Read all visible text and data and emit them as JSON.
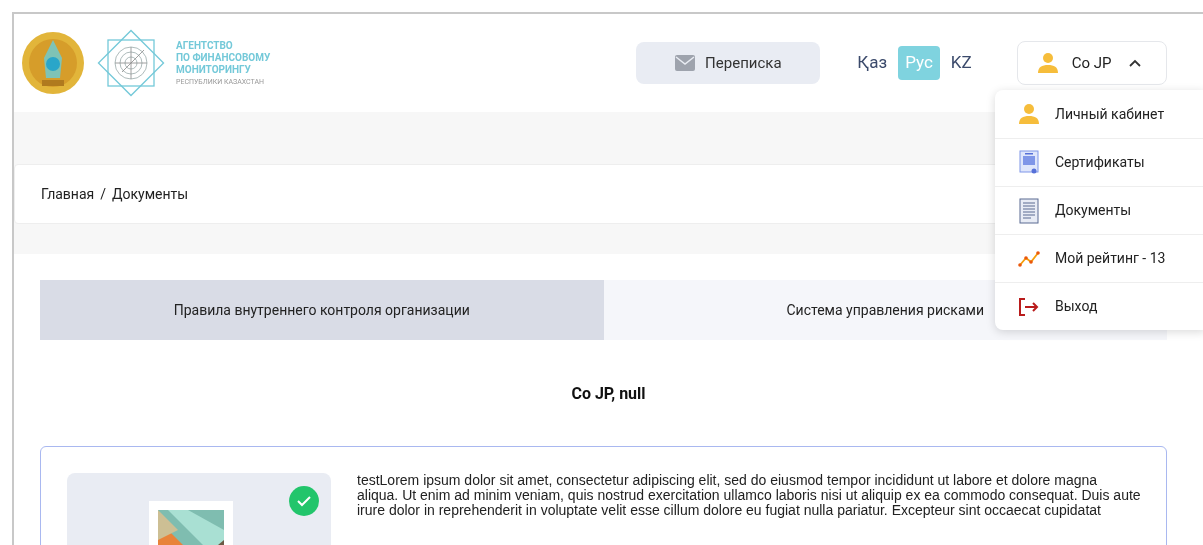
{
  "logo": {
    "title_lines": [
      "АГЕНТСТВО",
      "ПО ФИНАНСОВОМУ",
      "МОНИТОРИНГУ"
    ],
    "subtitle": "РЕСПУБЛИКИ КАЗАХСТАН"
  },
  "header": {
    "messages_button": "Переписка",
    "languages": [
      {
        "label": "Қаз",
        "selected": false
      },
      {
        "label": "Рус",
        "selected": true
      },
      {
        "label": "KZ",
        "selected": false
      }
    ],
    "user": {
      "name": "Co JP",
      "expanded": true
    }
  },
  "user_menu": [
    {
      "kind": "person",
      "label": "Личный кабинет"
    },
    {
      "kind": "certificate",
      "label": "Сертификаты"
    },
    {
      "kind": "document",
      "label": "Документы"
    },
    {
      "kind": "rating",
      "label": "Мой рейтинг - 13"
    },
    {
      "kind": "logout",
      "label": "Выход"
    }
  ],
  "breadcrumb": {
    "separator": "/",
    "items": [
      "Главная",
      "Документы"
    ]
  },
  "tabs": [
    {
      "label": "Правила внутреннего контроля организации",
      "selected": true
    },
    {
      "label": "Система управления рисками",
      "selected": false
    }
  ],
  "section_title": "Co JP, null",
  "document_card": {
    "approved": true,
    "description": "testLorem ipsum dolor sit amet, consectetur adipiscing elit, sed do eiusmod tempor incididunt ut labore et dolore magna aliqua. Ut enim ad minim veniam, quis nostrud exercitation ullamco laboris nisi ut aliquip ex ea commodo consequat. Duis aute irure dolor in reprehenderit in voluptate velit esse cillum dolore eu fugiat nulla pariatur. Excepteur sint occaecat cupidatat"
  }
}
